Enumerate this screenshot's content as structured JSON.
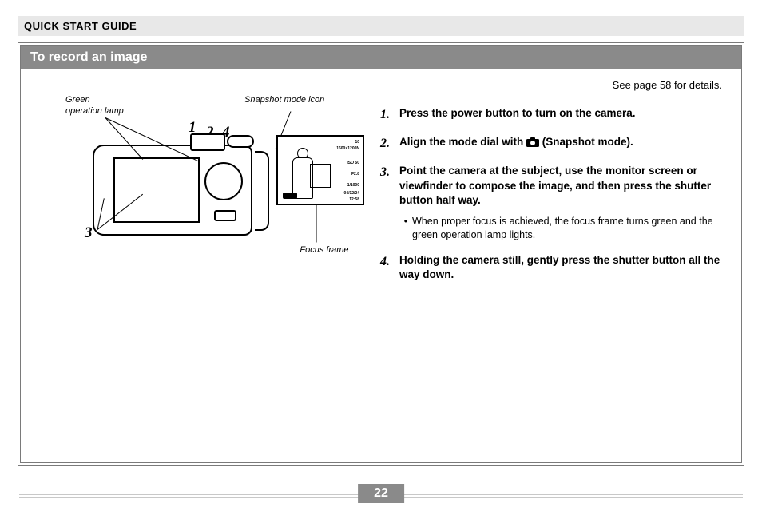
{
  "header": {
    "section": "QUICK START GUIDE"
  },
  "topic": {
    "title": "To record an image"
  },
  "see_page": "See page 58 for details.",
  "diagram": {
    "labels": {
      "green_lamp": "Green\noperation lamp",
      "snapshot_icon": "Snapshot mode icon",
      "focus_frame": "Focus frame"
    },
    "callouts": {
      "n1": "1",
      "n2": "2",
      "n3": "3",
      "n4": "4"
    },
    "inset": {
      "line1": "10",
      "line2": "1600×1200N",
      "line3": "ISO  50",
      "line4": "F2.8",
      "line5": "1/1000",
      "line6": "04/12/24",
      "line7": "12:58"
    }
  },
  "steps": [
    {
      "num": "1.",
      "text": "Press the power button to turn on the camera."
    },
    {
      "num": "2.",
      "pre": "Align the mode dial with ",
      "post": " (Snapshot mode)."
    },
    {
      "num": "3.",
      "text": "Point the camera at the subject, use the monitor screen or viewfinder to compose the image, and then press the shutter button half way.",
      "sub": [
        "When proper focus is achieved, the focus frame turns green and the green operation lamp lights."
      ]
    },
    {
      "num": "4.",
      "text": "Holding the camera still, gently press the shutter button all the way down."
    }
  ],
  "page_number": "22"
}
